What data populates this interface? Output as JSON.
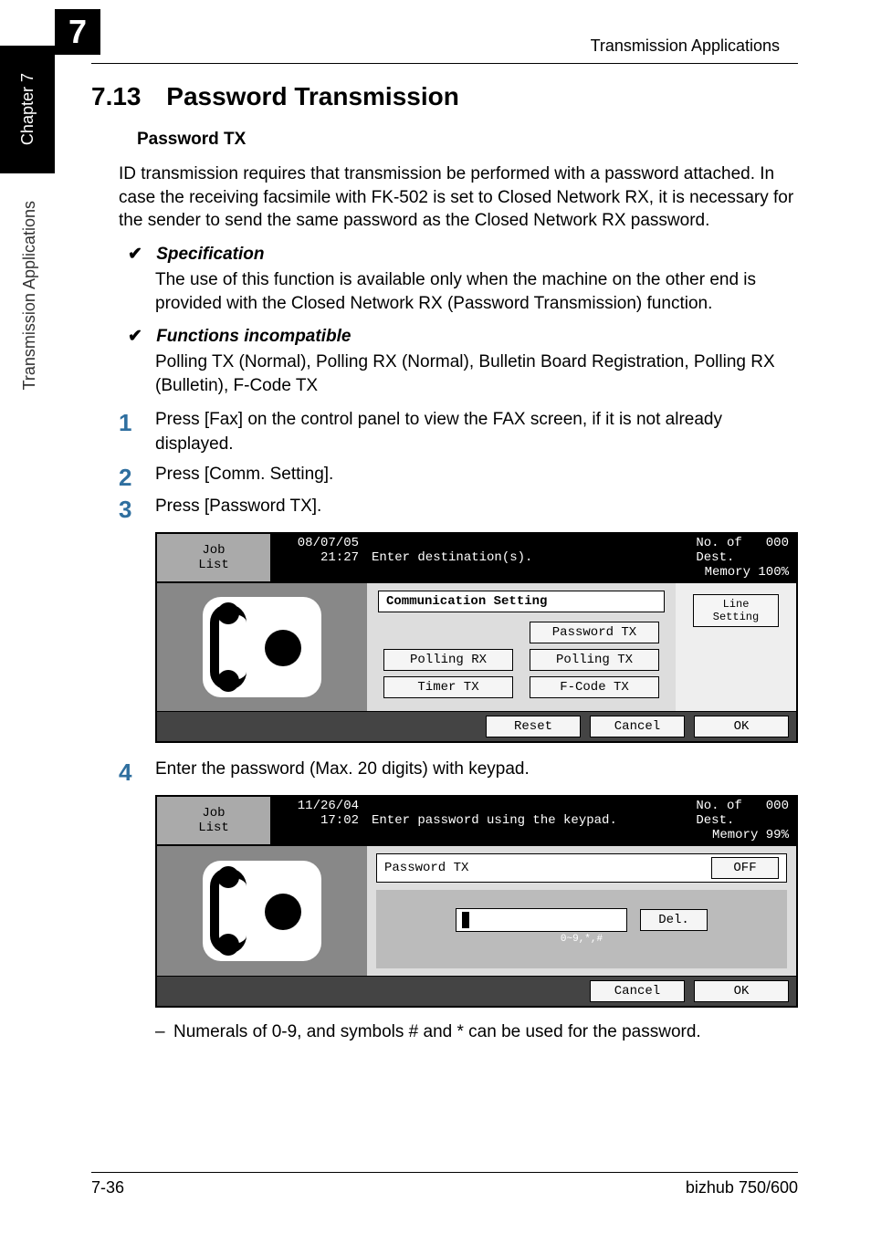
{
  "sidebar": {
    "chapter_label": "Chapter 7",
    "side_text": "Transmission Applications",
    "big_digit": "7"
  },
  "header": {
    "running_title": "Transmission Applications"
  },
  "section": {
    "number": "7.13",
    "title": "Password Transmission",
    "subtitle": "Password TX"
  },
  "body": {
    "intro": "ID transmission requires that transmission be performed with a password attached. In case the receiving facsimile with FK-502 is set to Closed Network RX, it is necessary for the sender to send the same password as the Closed Network RX password."
  },
  "checks": {
    "spec_label": "Specification",
    "spec_text": "The use of this function is available only when the machine on the other end is provided with the Closed Network RX (Password Transmission) function.",
    "incompat_label": "Functions incompatible",
    "incompat_text": "Polling TX (Normal), Polling RX (Normal), Bulletin Board Registration, Polling RX (Bulletin), F-Code TX"
  },
  "steps": {
    "s1": "Press [Fax] on the control panel to view the FAX screen, if it is not already displayed.",
    "s2": "Press [Comm. Setting].",
    "s3": "Press [Password TX].",
    "s4": "Enter the password (Max. 20 digits) with keypad.",
    "s4_sub": "Numerals of 0-9, and symbols # and * can be used for the password."
  },
  "screenshot1": {
    "job_list": "Job\nList",
    "date": "08/07/05",
    "time": "21:27",
    "message": "Enter destination(s).",
    "dest_label": "No. of\nDest.",
    "dest_count": "000",
    "memory_label": "Memory",
    "memory_value": "100%",
    "panel_title": "Communication Setting",
    "buttons": {
      "polling_rx": "Polling RX",
      "timer_tx": "Timer TX",
      "password_tx": "Password TX",
      "polling_tx": "Polling TX",
      "fcode_tx": "F-Code TX"
    },
    "side_button": "Line\nSetting",
    "footer": {
      "reset": "Reset",
      "cancel": "Cancel",
      "ok": "OK"
    }
  },
  "screenshot2": {
    "job_list": "Job\nList",
    "date": "11/26/04",
    "time": "17:02",
    "message": "Enter password using the keypad.",
    "dest_label": "No. of\nDest.",
    "dest_count": "000",
    "memory_label": "Memory",
    "memory_value": "99%",
    "panel_title": "Password TX",
    "off_button": "OFF",
    "input_hint": "0~9,*,#",
    "del_button": "Del.",
    "footer": {
      "cancel": "Cancel",
      "ok": "OK"
    }
  },
  "footer": {
    "page": "7-36",
    "product": "bizhub 750/600"
  }
}
